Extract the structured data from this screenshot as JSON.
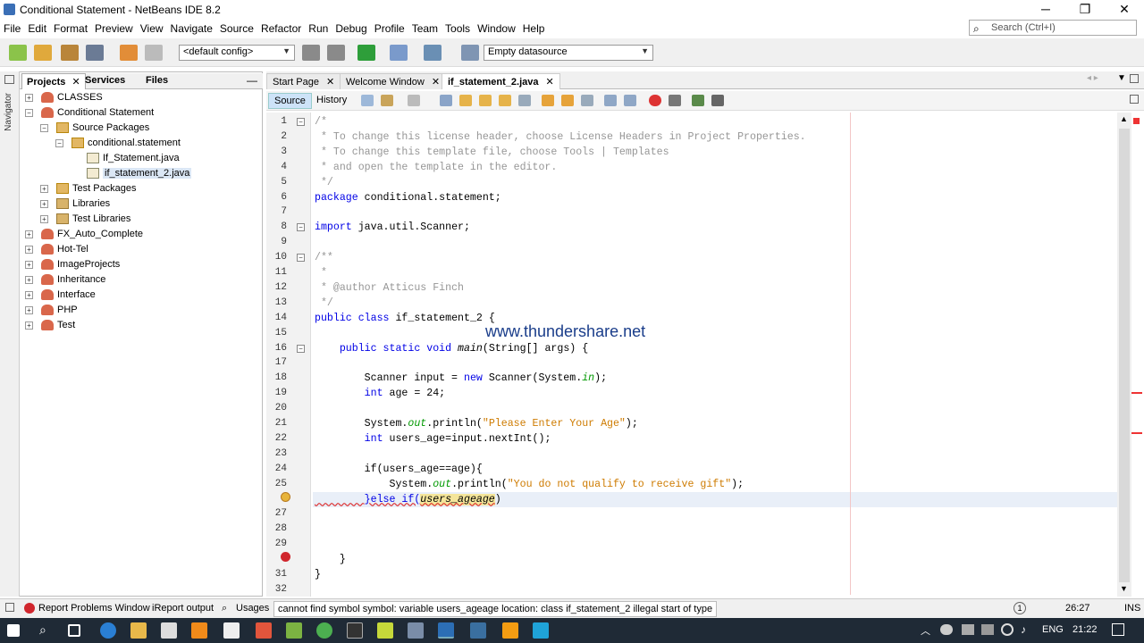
{
  "window": {
    "title": "Conditional Statement - NetBeans IDE 8.2",
    "min": "─",
    "max": "❐",
    "close": "✕"
  },
  "menu": [
    "File",
    "Edit",
    "Format",
    "Preview",
    "View",
    "Navigate",
    "Source",
    "Refactor",
    "Run",
    "Debug",
    "Profile",
    "Team",
    "Tools",
    "Window",
    "Help"
  ],
  "search": {
    "placeholder": "Search (Ctrl+I)"
  },
  "toolbar": {
    "config": "<default config>",
    "datasource": "Empty datasource"
  },
  "navigator_label": "Navigator",
  "panel_tabs": [
    {
      "label": "Projects",
      "active": true,
      "close": "✕"
    },
    {
      "label": "Services"
    },
    {
      "label": "Files"
    }
  ],
  "panel_minimize": "—",
  "tree": [
    {
      "label": "CLASSES",
      "level": 0,
      "icon": "project-icon",
      "exp": "+"
    },
    {
      "label": "Conditional Statement",
      "level": 0,
      "icon": "project-icon",
      "exp": "−"
    },
    {
      "label": "Source Packages",
      "level": 1,
      "icon": "package-folder-icon",
      "exp": "−"
    },
    {
      "label": "conditional.statement",
      "level": 2,
      "icon": "package-icon",
      "exp": "−"
    },
    {
      "label": "If_Statement.java",
      "level": 3,
      "icon": "java-file-icon",
      "exp": ""
    },
    {
      "label": "if_statement_2.java",
      "level": 3,
      "icon": "java-file-icon",
      "exp": "",
      "selected": true
    },
    {
      "label": "Test Packages",
      "level": 1,
      "icon": "package-folder-icon",
      "exp": "+"
    },
    {
      "label": "Libraries",
      "level": 1,
      "icon": "library-icon",
      "exp": "+"
    },
    {
      "label": "Test Libraries",
      "level": 1,
      "icon": "library-icon",
      "exp": "+"
    },
    {
      "label": "FX_Auto_Complete",
      "level": 0,
      "icon": "project-icon",
      "exp": "+"
    },
    {
      "label": "Hot-Tel",
      "level": 0,
      "icon": "project-icon",
      "exp": "+"
    },
    {
      "label": "ImageProjects",
      "level": 0,
      "icon": "project-icon",
      "exp": "+"
    },
    {
      "label": "Inheritance",
      "level": 0,
      "icon": "project-icon",
      "exp": "+"
    },
    {
      "label": "Interface",
      "level": 0,
      "icon": "project-icon",
      "exp": "+"
    },
    {
      "label": "PHP",
      "level": 0,
      "icon": "project-icon",
      "exp": "+"
    },
    {
      "label": "Test",
      "level": 0,
      "icon": "project-icon",
      "exp": "+"
    }
  ],
  "editor_tabs": [
    {
      "label": "Start Page",
      "close": "✕"
    },
    {
      "label": "Welcome Window",
      "close": "✕"
    },
    {
      "label": "if_statement_2.java",
      "active": true,
      "close": "✕"
    }
  ],
  "editor_modes": {
    "source": "Source",
    "history": "History"
  },
  "code_lines": [
    {
      "n": "1",
      "fold": "−",
      "parts": [
        {
          "t": "/*",
          "c": "cm"
        }
      ]
    },
    {
      "n": "2",
      "parts": [
        {
          "t": " * To change this license header, choose License Headers in Project Properties.",
          "c": "cm"
        }
      ]
    },
    {
      "n": "3",
      "parts": [
        {
          "t": " * To change this template file, choose Tools | Templates",
          "c": "cm"
        }
      ]
    },
    {
      "n": "4",
      "parts": [
        {
          "t": " * and open the template in the editor.",
          "c": "cm"
        }
      ]
    },
    {
      "n": "5",
      "parts": [
        {
          "t": " */",
          "c": "cm"
        }
      ]
    },
    {
      "n": "6",
      "parts": [
        {
          "t": "package",
          "c": "kw"
        },
        {
          "t": " conditional.statement;",
          "c": ""
        }
      ]
    },
    {
      "n": "7",
      "parts": []
    },
    {
      "n": "8",
      "fold": "−",
      "parts": [
        {
          "t": "import",
          "c": "kw"
        },
        {
          "t": " java.util.Scanner;",
          "c": ""
        }
      ]
    },
    {
      "n": "9",
      "parts": []
    },
    {
      "n": "10",
      "fold": "−",
      "parts": [
        {
          "t": "/**",
          "c": "cm"
        }
      ]
    },
    {
      "n": "11",
      "parts": [
        {
          "t": " *",
          "c": "cm"
        }
      ]
    },
    {
      "n": "12",
      "parts": [
        {
          "t": " * @author Atticus Finch",
          "c": "cm"
        }
      ]
    },
    {
      "n": "13",
      "parts": [
        {
          "t": " */",
          "c": "cm"
        }
      ]
    },
    {
      "n": "14",
      "parts": [
        {
          "t": "public class",
          "c": "kw"
        },
        {
          "t": " if_statement_2 {",
          "c": ""
        }
      ]
    },
    {
      "n": "15",
      "parts": []
    },
    {
      "n": "16",
      "fold": "−",
      "parts": [
        {
          "t": "    public static void",
          "c": "kw"
        },
        {
          "t": " ",
          "c": ""
        },
        {
          "t": "main",
          "c": "it"
        },
        {
          "t": "(String[] args) {",
          "c": ""
        }
      ]
    },
    {
      "n": "17",
      "parts": []
    },
    {
      "n": "18",
      "parts": [
        {
          "t": "        Scanner input = ",
          "c": ""
        },
        {
          "t": "new",
          "c": "kw"
        },
        {
          "t": " Scanner(System.",
          "c": ""
        },
        {
          "t": "in",
          "c": "fl"
        },
        {
          "t": ");",
          "c": ""
        }
      ]
    },
    {
      "n": "19",
      "parts": [
        {
          "t": "        ",
          "c": ""
        },
        {
          "t": "int",
          "c": "kw"
        },
        {
          "t": " age = 24;",
          "c": ""
        }
      ]
    },
    {
      "n": "20",
      "parts": []
    },
    {
      "n": "21",
      "parts": [
        {
          "t": "        System.",
          "c": ""
        },
        {
          "t": "out",
          "c": "fl"
        },
        {
          "t": ".println(",
          "c": ""
        },
        {
          "t": "\"Please Enter Your Age\"",
          "c": "st"
        },
        {
          "t": ");",
          "c": ""
        }
      ]
    },
    {
      "n": "22",
      "parts": [
        {
          "t": "        ",
          "c": ""
        },
        {
          "t": "int",
          "c": "kw"
        },
        {
          "t": " users_age=input.nextInt();",
          "c": ""
        }
      ]
    },
    {
      "n": "23",
      "parts": []
    },
    {
      "n": "24",
      "parts": [
        {
          "t": "        if(users_age==age){",
          "c": ""
        }
      ]
    },
    {
      "n": "25",
      "parts": [
        {
          "t": "            System.",
          "c": ""
        },
        {
          "t": "out",
          "c": "fl"
        },
        {
          "t": ".println(",
          "c": ""
        },
        {
          "t": "\"You do not qualify to receive gift\"",
          "c": "st"
        },
        {
          "t": ");",
          "c": ""
        }
      ]
    },
    {
      "n": "",
      "hl": true,
      "parts": [
        {
          "t": "        }else if(",
          "c": "kw"
        },
        {
          "t": "users_ageage",
          "c": "it"
        },
        {
          "t": ")",
          "c": ""
        }
      ]
    },
    {
      "n": "27",
      "parts": []
    },
    {
      "n": "28",
      "parts": []
    },
    {
      "n": "29",
      "parts": []
    },
    {
      "n": "",
      "parts": [
        {
          "t": "    }",
          "c": ""
        }
      ]
    },
    {
      "n": "31",
      "parts": [
        {
          "t": "}",
          "c": ""
        }
      ]
    },
    {
      "n": "32",
      "parts": []
    }
  ],
  "watermark": "www.thundershare.net",
  "status": {
    "report": "Report Problems Window",
    "ireport": "iReport output",
    "usages": "Usages",
    "message": "cannot find symbol  symbol:  variable users_ageage  location: class if_statement_2  illegal start of type",
    "notif": "1",
    "pos": "26:27",
    "mode": "INS"
  },
  "taskbar": {
    "lang": "ENG",
    "time": "21:22"
  }
}
